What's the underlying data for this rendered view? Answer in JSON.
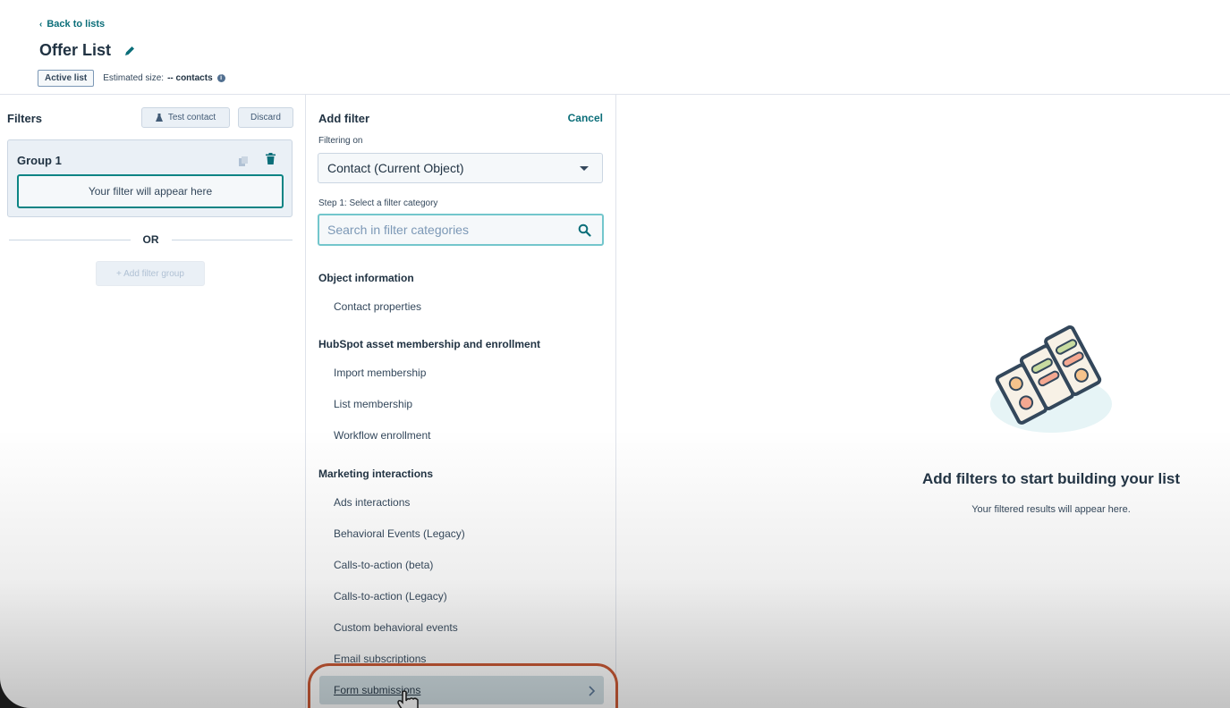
{
  "header": {
    "back_link": "Back to lists",
    "title": "Offer List",
    "badge": "Active list",
    "estimated_label": "Estimated size:",
    "estimated_value": "-- contacts"
  },
  "filters_panel": {
    "title": "Filters",
    "test_contact": "Test contact",
    "discard": "Discard",
    "group_title": "Group 1",
    "placeholder": "Your filter will appear here",
    "or": "OR",
    "add_group": "+ Add filter group"
  },
  "add_filter": {
    "title": "Add filter",
    "cancel": "Cancel",
    "filtering_on_label": "Filtering on",
    "filtering_on_value": "Contact (Current Object)",
    "step_label": "Step 1: Select a filter category",
    "search_placeholder": "Search in filter categories",
    "sections": [
      {
        "header": "Object information",
        "items": [
          "Contact properties"
        ]
      },
      {
        "header": "HubSpot asset membership and enrollment",
        "items": [
          "Import membership",
          "List membership",
          "Workflow enrollment"
        ]
      },
      {
        "header": "Marketing interactions",
        "items": [
          "Ads interactions",
          "Behavioral Events (Legacy)",
          "Calls-to-action (beta)",
          "Calls-to-action (Legacy)",
          "Custom behavioral events",
          "Email subscriptions",
          "Form submissions"
        ]
      }
    ]
  },
  "empty_state": {
    "title": "Add filters to start building your list",
    "subtitle": "Your filtered results will appear here."
  },
  "colors": {
    "accent": "#0b6e79",
    "highlight": "#c8512b",
    "border_teal": "#0b8484"
  },
  "icons": [
    "chevron-left-icon",
    "pencil-icon",
    "info-icon",
    "flask-icon",
    "copy-icon",
    "trash-icon",
    "caret-down-icon",
    "search-icon",
    "chevron-right-icon",
    "hand-cursor-icon"
  ]
}
